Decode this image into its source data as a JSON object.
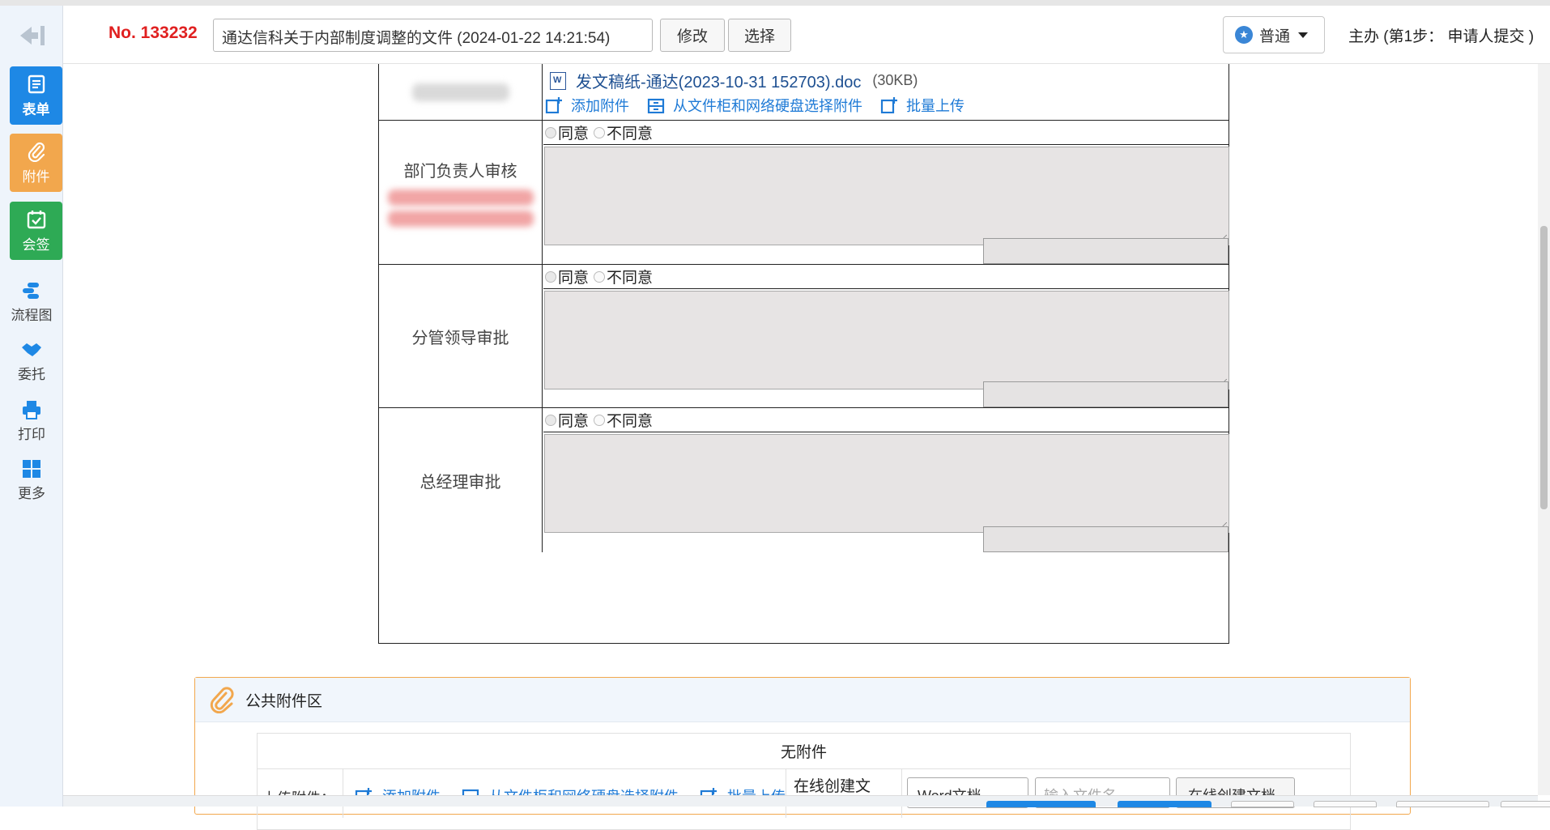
{
  "topbar": {
    "doc_no": "No. 133232",
    "title_value": "通达信科关于内部制度调整的文件 (2024-01-22 14:21:54)",
    "edit_label": "修改",
    "select_label": "选择",
    "priority_label": "普通",
    "step_info": "主办 (第1步： 申请人提交 )"
  },
  "sidebar": {
    "tiles": [
      {
        "label": "表单",
        "icon": "form-icon",
        "color": "#1e88e5"
      },
      {
        "label": "附件",
        "icon": "paperclip-icon",
        "color": "#f2a74d"
      },
      {
        "label": "会签",
        "icon": "calendar-check-icon",
        "color": "#2eaa55"
      }
    ],
    "links": [
      {
        "label": "流程图",
        "icon": "flowchart-icon"
      },
      {
        "label": "委托",
        "icon": "handshake-icon"
      },
      {
        "label": "打印",
        "icon": "printer-icon"
      },
      {
        "label": "更多",
        "icon": "grid-icon"
      }
    ]
  },
  "form": {
    "attachment": {
      "file_name": "发文稿纸-通达(2023-10-31 152703).doc",
      "file_size": "(30KB)",
      "actions": [
        "添加附件",
        "从文件柜和网络硬盘选择附件",
        "批量上传"
      ]
    },
    "sections": [
      {
        "label": "部门负责人审核",
        "agree": "同意",
        "disagree": "不同意"
      },
      {
        "label": "分管领导审批",
        "agree": "同意",
        "disagree": "不同意"
      },
      {
        "label": "总经理审批",
        "agree": "同意",
        "disagree": "不同意"
      }
    ]
  },
  "public_zone": {
    "title": "公共附件区",
    "empty_text": "无附件",
    "upload_label": "上传附件：",
    "actions": [
      "添加附件",
      "从文件柜和网络硬盘选择附件",
      "批量上传"
    ],
    "online_label": "在线创建文",
    "doc_type": "Word文档",
    "file_name_placeholder": "输入文件名",
    "create_button": "在线创建文档"
  },
  "colors": {
    "accent_blue": "#1e88e5",
    "doc_no_red": "#e02020",
    "link_blue": "#1e7ad6",
    "attach_orange": "#f2a74d",
    "sign_green": "#2eaa55"
  }
}
